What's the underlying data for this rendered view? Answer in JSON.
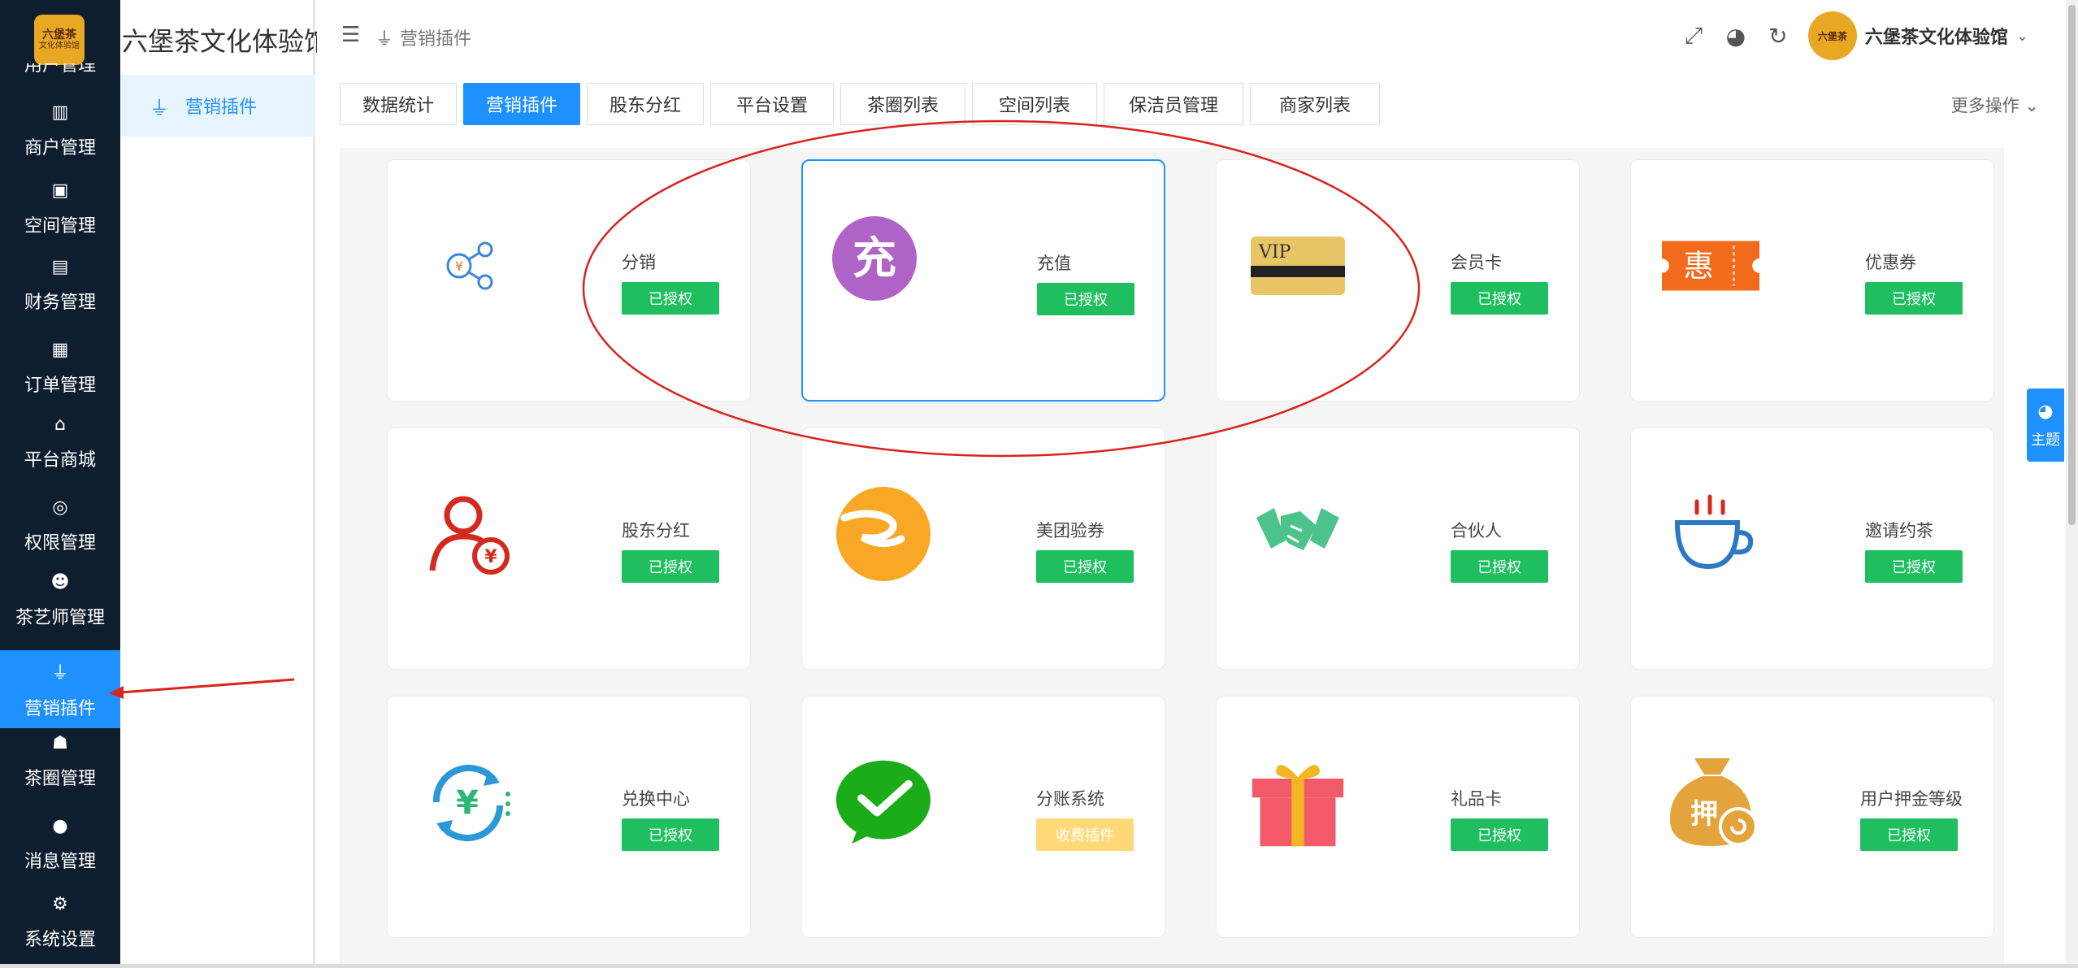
{
  "rail": {
    "logo_top": "六堡茶",
    "logo_bottom": "文化体验馆",
    "partial_label": "用户管理",
    "items": [
      {
        "label": "商户管理",
        "icon": "store-icon"
      },
      {
        "label": "空间管理",
        "icon": "box-icon"
      },
      {
        "label": "财务管理",
        "icon": "wallet-icon"
      },
      {
        "label": "订单管理",
        "icon": "clipboard-icon"
      },
      {
        "label": "平台商城",
        "icon": "shop-icon"
      },
      {
        "label": "权限管理",
        "icon": "coins-icon"
      },
      {
        "label": "茶艺师管理",
        "icon": "user-clock-icon"
      },
      {
        "label": "营销插件",
        "icon": "plug-icon",
        "active": true
      },
      {
        "label": "茶圈管理",
        "icon": "users-icon"
      },
      {
        "label": "消息管理",
        "icon": "message-icon"
      },
      {
        "label": "系统设置",
        "icon": "gear-icon"
      }
    ]
  },
  "subside": {
    "brand": "六堡茶文化体验馆",
    "item": "营销插件"
  },
  "header": {
    "breadcrumb": "营销插件",
    "user_name": "六堡茶文化体验馆",
    "avatar_text": "六堡茶"
  },
  "tabs": [
    {
      "label": "数据统计"
    },
    {
      "label": "营销插件",
      "active": true
    },
    {
      "label": "股东分红"
    },
    {
      "label": "平台设置"
    },
    {
      "label": "茶圈列表"
    },
    {
      "label": "空间列表"
    },
    {
      "label": "保洁员管理"
    },
    {
      "label": "商家列表"
    }
  ],
  "more_actions": "更多操作",
  "plugins": [
    {
      "title": "分销",
      "button": "已授权",
      "icon": "share-icon"
    },
    {
      "title": "充值",
      "button": "已授权",
      "icon": "recharge-icon",
      "icon_text": "充",
      "selected": true
    },
    {
      "title": "会员卡",
      "button": "已授权",
      "icon": "vip-card-icon",
      "icon_text": "VIP"
    },
    {
      "title": "优惠券",
      "button": "已授权",
      "icon": "coupon-icon",
      "icon_text": "惠"
    },
    {
      "title": "股东分红",
      "button": "已授权",
      "icon": "shareholder-icon"
    },
    {
      "title": "美团验券",
      "button": "已授权",
      "icon": "meituan-icon"
    },
    {
      "title": "合伙人",
      "button": "已授权",
      "icon": "handshake-icon"
    },
    {
      "title": "邀请约茶",
      "button": "已授权",
      "icon": "tea-cup-icon"
    },
    {
      "title": "兑换中心",
      "button": "已授权",
      "icon": "exchange-icon"
    },
    {
      "title": "分账系统",
      "button": "收费插件",
      "icon": "wechat-pay-icon",
      "paid": true
    },
    {
      "title": "礼品卡",
      "button": "已授权",
      "icon": "gift-icon"
    },
    {
      "title": "用户押金等级",
      "button": "已授权",
      "icon": "deposit-bag-icon",
      "icon_text": "押"
    }
  ],
  "theme": {
    "label": "主题"
  },
  "colors": {
    "primary": "#1e90ff",
    "rail_bg": "#0f1e2e",
    "authorized": "#1fbf60",
    "paid": "#ffd978",
    "annotation": "#d9231e"
  }
}
